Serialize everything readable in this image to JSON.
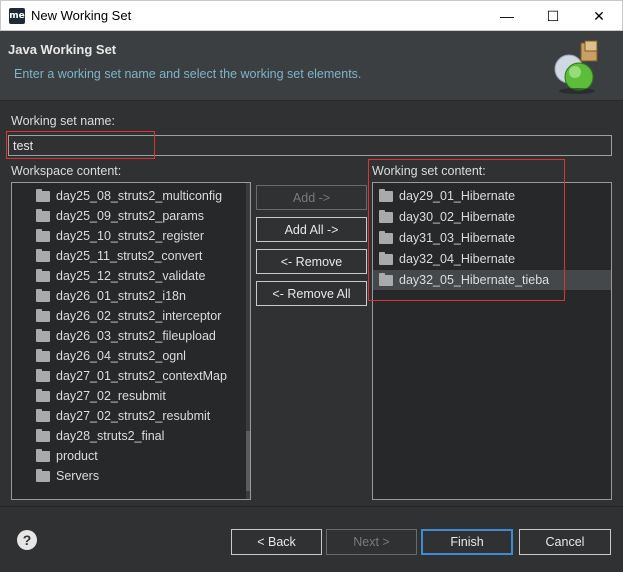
{
  "window": {
    "title": "New Working Set",
    "app_icon_text": "me",
    "controls": {
      "minimize": "—",
      "maximize": "☐",
      "close": "✕"
    }
  },
  "banner": {
    "title": "Java Working Set",
    "description": "Enter a working set name and select the working set elements."
  },
  "name_field": {
    "label": "Working set name:",
    "value": "test"
  },
  "workspace": {
    "label": "Workspace content:",
    "items": [
      "day25_08_struts2_multiconfig",
      "day25_09_struts2_params",
      "day25_10_struts2_register",
      "day25_11_struts2_convert",
      "day25_12_struts2_validate",
      "day26_01_struts2_i18n",
      "day26_02_struts2_interceptor",
      "day26_03_struts2_fileupload",
      "day26_04_struts2_ognl",
      "day27_01_struts2_contextMap",
      "day27_02_resubmit",
      "day27_02_struts2_resubmit",
      "day28_struts2_final",
      "product",
      "Servers"
    ]
  },
  "working_set": {
    "label": "Working set content:",
    "items": [
      "day29_01_Hibernate",
      "day30_02_Hibernate",
      "day31_03_Hibernate",
      "day32_04_Hibernate",
      "day32_05_Hibernate_tieba"
    ],
    "selected_index": 4
  },
  "buttons": {
    "add": "Add ->",
    "add_all": "Add All ->",
    "remove": "<- Remove",
    "remove_all": "<- Remove All",
    "back": "< Back",
    "next": "Next >",
    "finish": "Finish",
    "cancel": "Cancel"
  },
  "help": {
    "glyph": "?"
  },
  "colors": {
    "background": "#2f3132",
    "banner": "#3c3f41",
    "banner_desc": "#7fb3c9",
    "highlight": "#d9343a",
    "default_button": "#3f8cd6"
  }
}
